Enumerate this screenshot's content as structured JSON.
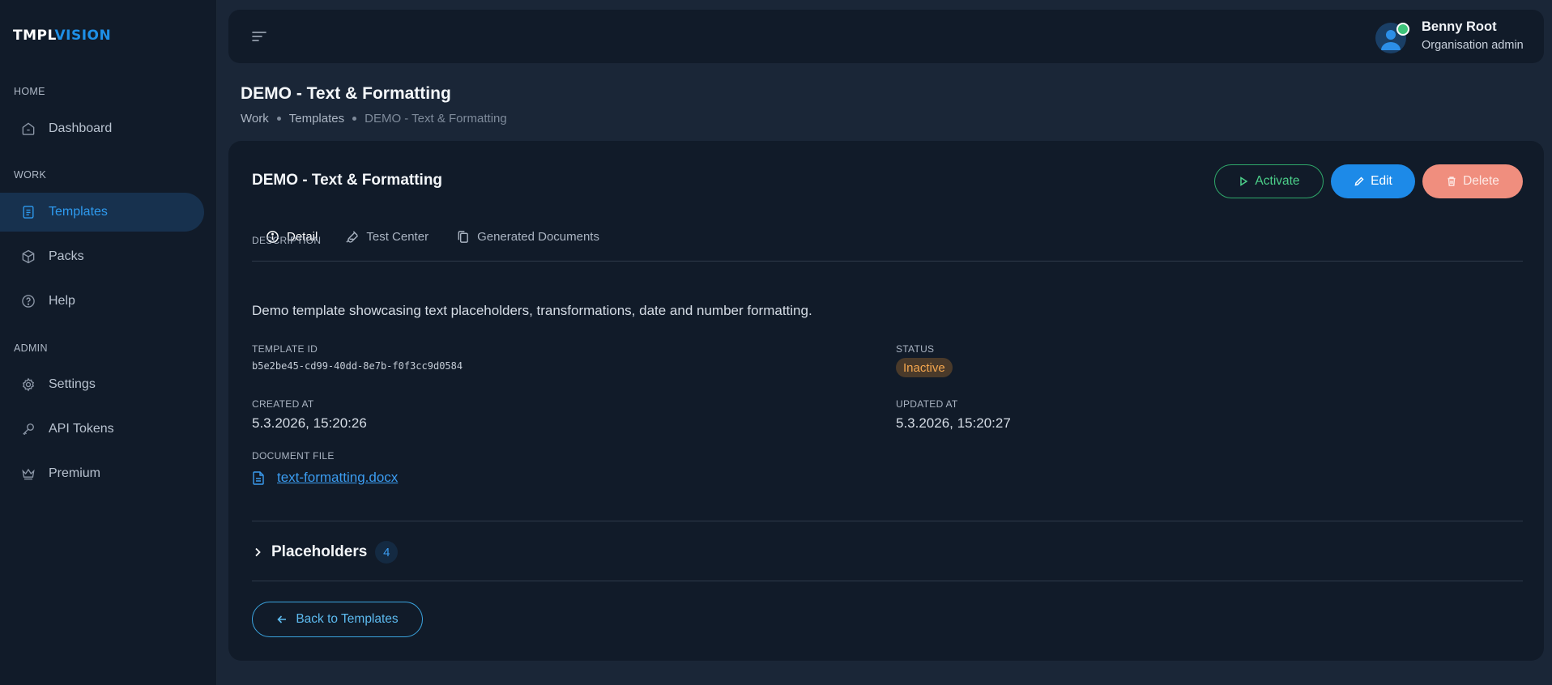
{
  "brand": {
    "part1": "TMPL",
    "part2": "VISION"
  },
  "sidebar": {
    "sections": [
      {
        "label": "HOME"
      },
      {
        "label": "WORK"
      },
      {
        "label": "ADMIN"
      }
    ],
    "items": [
      {
        "label": "Dashboard",
        "icon": "home-icon"
      },
      {
        "label": "Templates",
        "icon": "document-icon",
        "active": true
      },
      {
        "label": "Packs",
        "icon": "cube-icon"
      },
      {
        "label": "Help",
        "icon": "help-icon"
      },
      {
        "label": "Settings",
        "icon": "gear-icon"
      },
      {
        "label": "API Tokens",
        "icon": "key-icon"
      },
      {
        "label": "Premium",
        "icon": "crown-icon"
      }
    ]
  },
  "user": {
    "name": "Benny Root",
    "role": "Organisation admin",
    "status_color": "#3ec47a"
  },
  "page": {
    "title": "DEMO - Text & Formatting",
    "breadcrumb": [
      "Work",
      "Templates",
      "DEMO - Text & Formatting"
    ]
  },
  "card": {
    "title": "DEMO - Text & Formatting",
    "actions": {
      "activate": "Activate",
      "edit": "Edit",
      "delete": "Delete"
    },
    "tabs": [
      "Detail",
      "Test Center",
      "Generated Documents"
    ],
    "fields": {
      "description_label": "DESCRIPTION",
      "description": "Demo template showcasing text placeholders, transformations, date and number formatting.",
      "template_id_label": "TEMPLATE ID",
      "template_id": "b5e2be45-cd99-40dd-8e7b-f0f3cc9d0584",
      "status_label": "STATUS",
      "status": "Inactive",
      "created_label": "CREATED AT",
      "created": "5.3.2026, 15:20:26",
      "updated_label": "UPDATED AT",
      "updated": "5.3.2026, 15:20:27",
      "document_label": "DOCUMENT FILE",
      "document": "text-formatting.docx"
    },
    "placeholders": {
      "label": "Placeholders",
      "count": "4"
    },
    "back_label": "Back to Templates"
  },
  "colors": {
    "accent": "#1d8ae8",
    "success": "#4cd08a",
    "danger": "#f08e7e",
    "warning": "#f4a64e"
  }
}
